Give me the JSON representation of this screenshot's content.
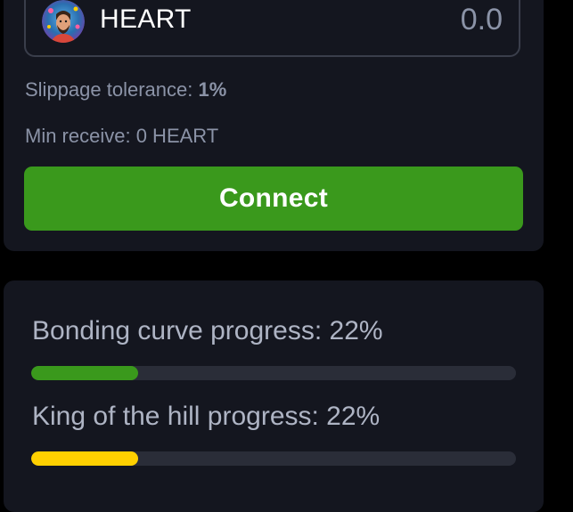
{
  "trade": {
    "token_symbol": "HEART",
    "amount_value": "0.0",
    "slippage_label": "Slippage tolerance: ",
    "slippage_value": "1%",
    "min_receive_text": "Min receive: 0 HEART",
    "connect_label": "Connect"
  },
  "progress": {
    "bonding_label": "Bonding curve progress: 22%",
    "bonding_percent": 22,
    "bonding_color": "#3a991c",
    "koth_label": "King of the hill progress: 22%",
    "koth_percent": 22,
    "koth_color": "#ffd000"
  },
  "colors": {
    "background": "#000000",
    "card": "#14161f",
    "muted_text": "#8b93a7",
    "accent_green": "#3a991c",
    "accent_yellow": "#ffd000"
  },
  "icons": {
    "token_avatar": "token-avatar-icon"
  }
}
